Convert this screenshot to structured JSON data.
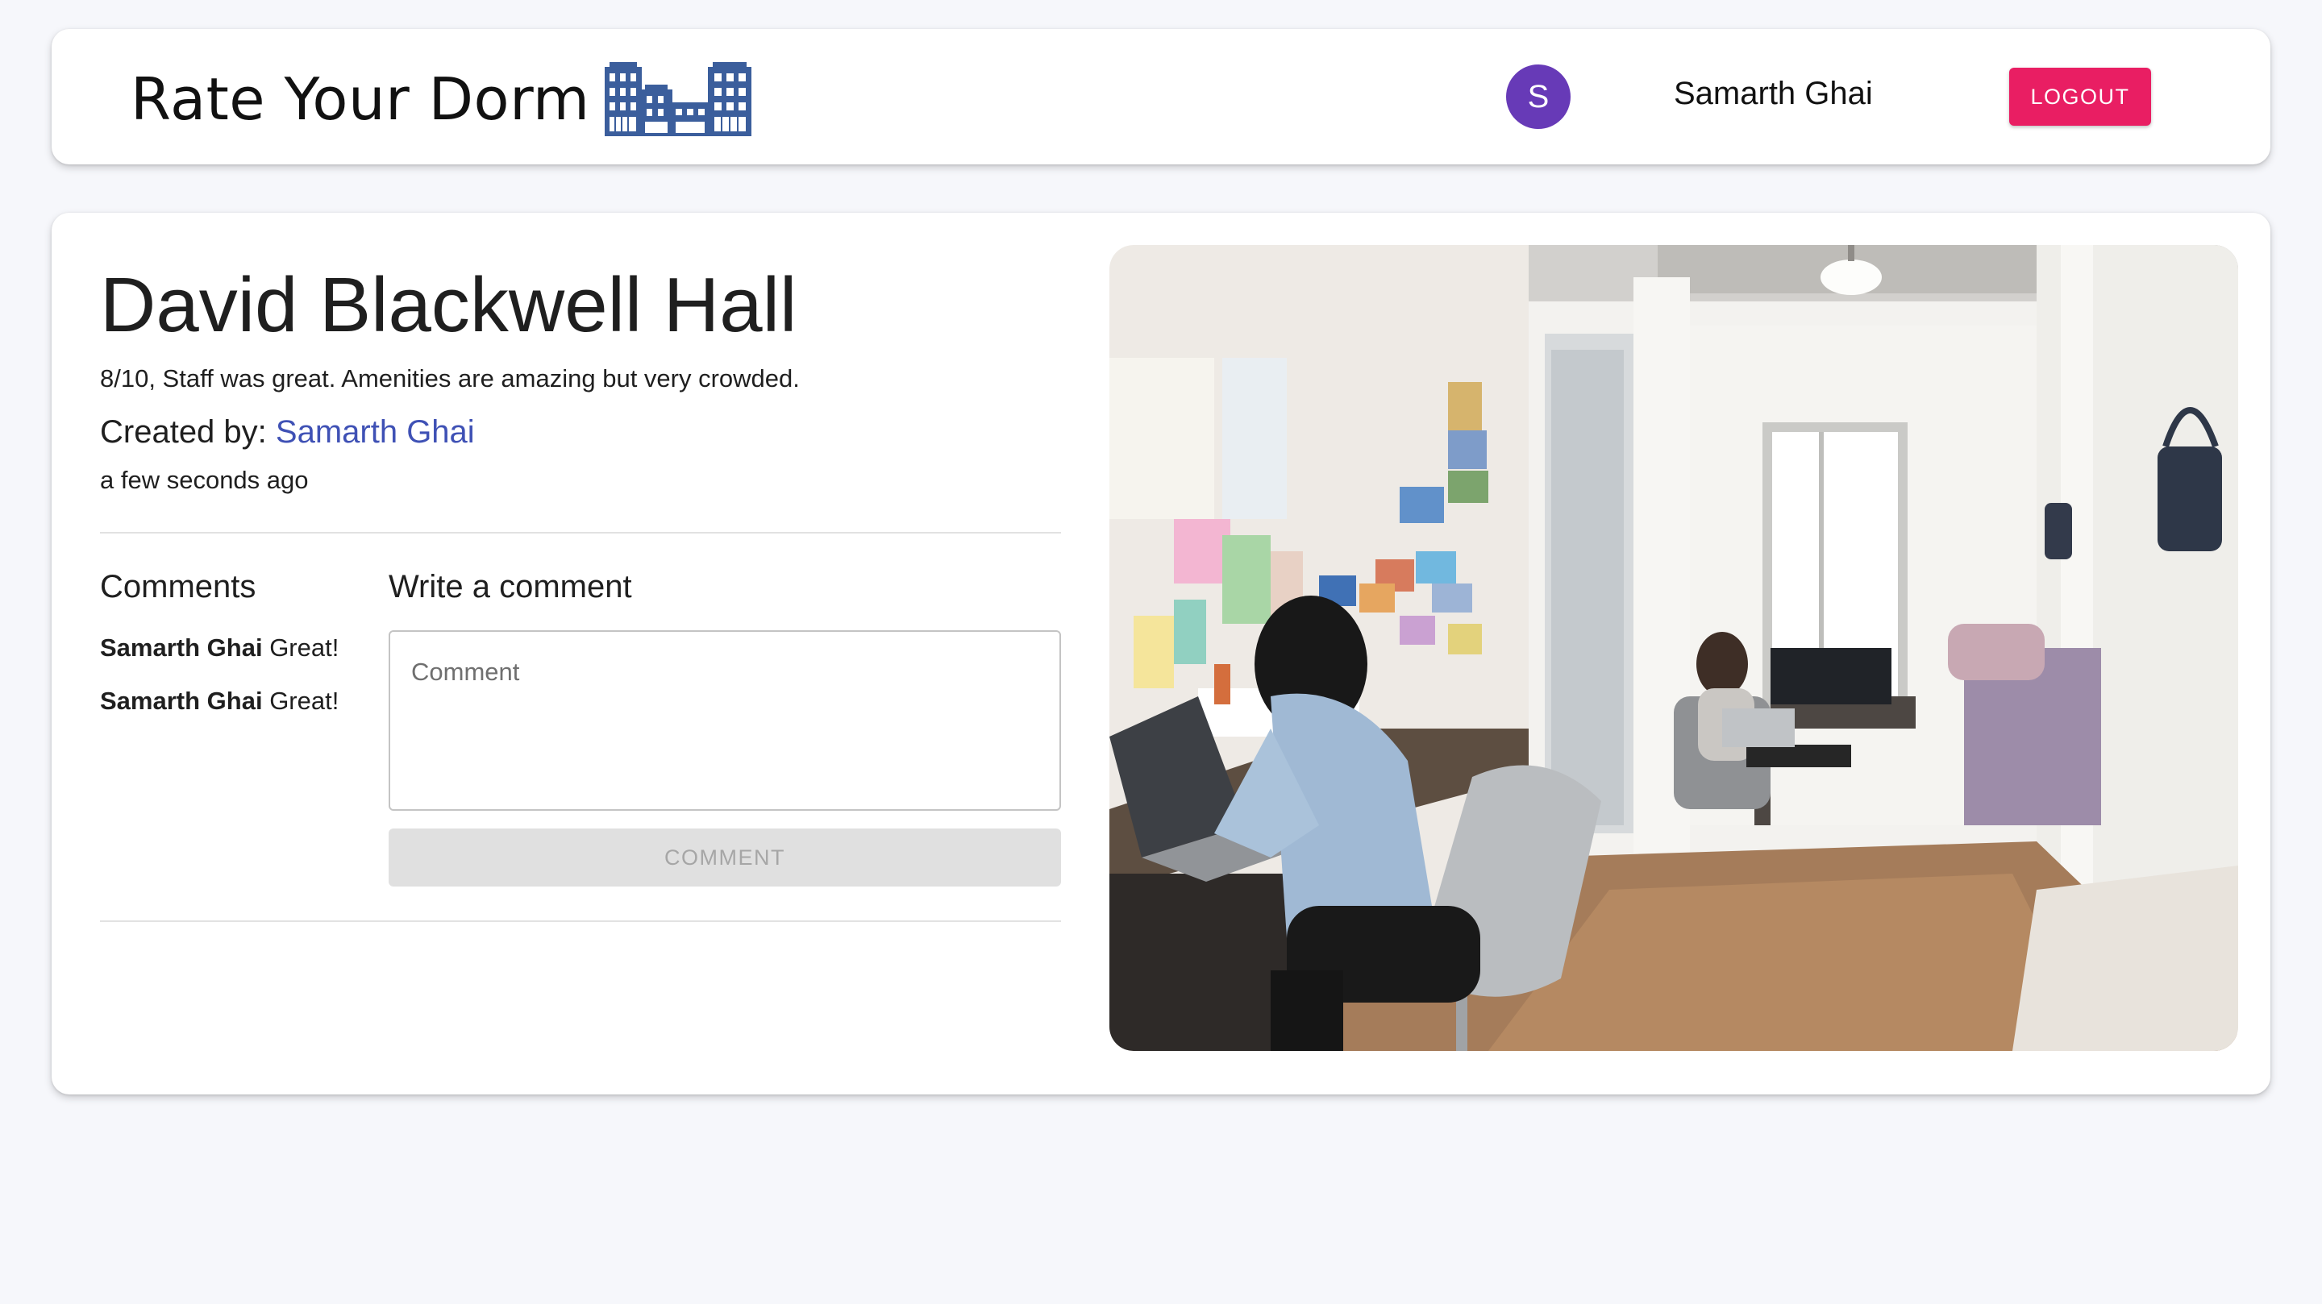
{
  "header": {
    "brand_title": "Rate Your Dorm",
    "logo_icon": "dorm-buildings-icon",
    "avatar_initial": "S",
    "user_name": "Samarth Ghai",
    "logout_label": "LOGOUT"
  },
  "dorm": {
    "title": "David Blackwell Hall",
    "review": "8/10, Staff was great. Amenities are amazing but very crowded.",
    "created_by_label": "Created by:",
    "author": "Samarth Ghai",
    "time": "a few seconds ago"
  },
  "comments": {
    "heading": "Comments",
    "items": [
      {
        "author": "Samarth Ghai",
        "text": "Great!"
      },
      {
        "author": "Samarth Ghai",
        "text": "Great!"
      }
    ]
  },
  "write_comment": {
    "heading": "Write a comment",
    "placeholder": "Comment",
    "button_label": "COMMENT"
  },
  "colors": {
    "accent": "#3f51b5",
    "avatar": "#673ab7",
    "logout": "#e91e63",
    "logo": "#3b5e9c"
  }
}
